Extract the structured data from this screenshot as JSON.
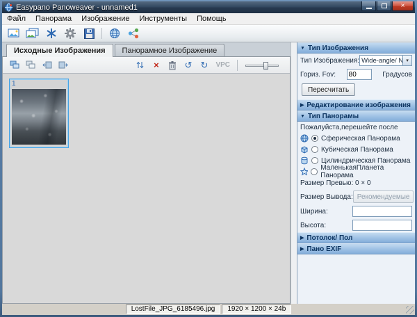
{
  "window": {
    "title": "Easypano Panoweaver - unnamed1"
  },
  "menubar": {
    "items": [
      "Файл",
      "Панорама",
      "Изображение",
      "Инструменты",
      "Помощь"
    ]
  },
  "tabs": {
    "source": "Исходные Изображения",
    "panorama": "Панорамное Изображение"
  },
  "image_toolbar": {
    "vpc_label": "VPC"
  },
  "thumbnail": {
    "index": "1"
  },
  "right_panel": {
    "image_type": {
      "title": "Тип Изображения",
      "type_label": "Тип Изображения:",
      "type_value": "Wide-angle/ N",
      "fov_label": "Гориз. Fov:",
      "fov_value": "80",
      "fov_unit": "Градусов",
      "recalc_button": "Пересчитать"
    },
    "editing": {
      "title": "Редактирование изображения"
    },
    "pano_type": {
      "title": "Тип Панорамы",
      "note": "Пожалуйста,перешейте после",
      "options": [
        "Сферическая Панорама",
        "Кубическая Панорама",
        "Цилиндрическая Панорама",
        "МаленькаяПланета Панорама"
      ],
      "selected_index": 0,
      "preview_size": "Размер Превью: 0 × 0",
      "output_label": "Размер Вывода:",
      "recommended_button": "Рекомендуемые",
      "width_label": "Ширина:",
      "height_label": "Высота:",
      "width_value": "",
      "height_value": ""
    },
    "ceiling_floor": {
      "title": "Потолок/ Пол"
    },
    "pano_exif": {
      "title": "Пано EXIF"
    }
  },
  "statusbar": {
    "filename": "LostFile_JPG_6185496.jpg",
    "dimensions": "1920 × 1200 × 24b"
  },
  "icons": {
    "close": "×",
    "delete_cross": "×",
    "rotate_ccw": "↺",
    "rotate_cw": "↻",
    "dropdown_arrow": "▾",
    "section_expanded": "▼",
    "section_collapsed": "▶"
  },
  "colors": {
    "accent": "#2f6bb3",
    "header_text": "#0d3561",
    "selection_border": "#45a3e6",
    "close_button": "#bc3a24"
  }
}
